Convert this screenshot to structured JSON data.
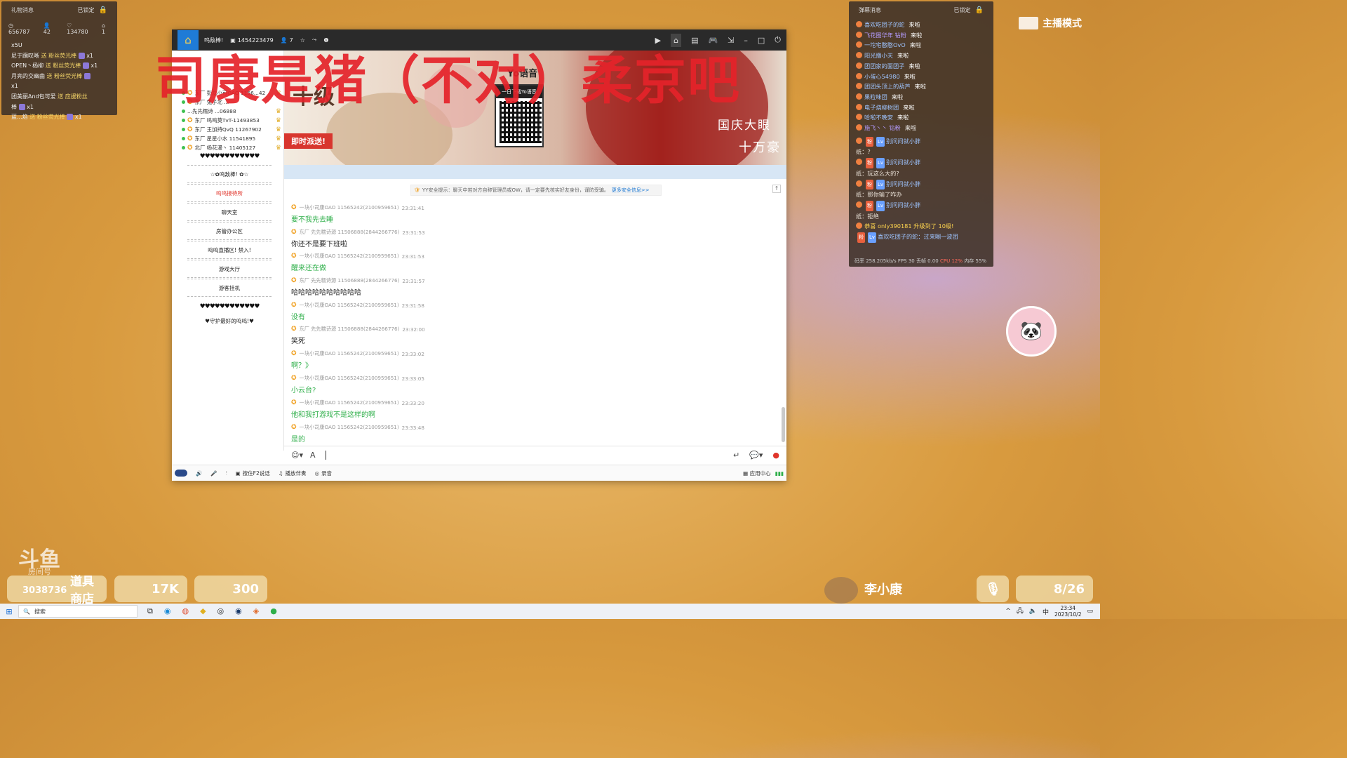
{
  "gift_panel": {
    "title": "礼物消息",
    "lock_label": "已锁定",
    "stats": [
      "656787",
      "42",
      "134780",
      "1"
    ],
    "items": [
      {
        "text": "x5U",
        "act": "",
        "gift": "",
        "count": ""
      },
      {
        "text": "尼于躏叹晰",
        "act": "送 粉丝荧光棒",
        "count": "x1"
      },
      {
        "text": "OPEN丶杨柳",
        "act": "送 粉丝荧光棒",
        "count": "x1"
      },
      {
        "text": "月亮的交幽曲",
        "act": "送 粉丝荧光棒",
        "count": ""
      },
      {
        "text": "x1",
        "act": "",
        "count": ""
      },
      {
        "text": "团美丽And包可爱",
        "act": "送 应援粉丝",
        "count": ""
      },
      {
        "text": "棒",
        "act": "",
        "count": "x1"
      },
      {
        "text": "蓝...焰",
        "act": "送 粉丝荧光棒",
        "count": "x1"
      }
    ]
  },
  "danmaku_panel": {
    "title": "弹幕消息",
    "lock_label": "已锁定",
    "arrivals": [
      "喜欢吃团子的蛇",
      "飞花图华年 钻粉",
      "一坨宅憨憨OvO",
      "阳光撸小天",
      "团团家的面团子",
      "小蛋心54980",
      "团团头顶上的葫芦",
      "果粒味团",
      "电子烧柳树团",
      "哈啦不晚安",
      "施飞丶丶 钻粉"
    ],
    "arrive_suffix": "来啦",
    "messages": [
      {
        "name": "别问问就小胖",
        "content": "纸：?"
      },
      {
        "name": "别问问就小胖",
        "content": "纸：玩这么大的?"
      },
      {
        "name": "别问问就小胖",
        "content": "纸：那你输了咋办"
      },
      {
        "name": "别问问就小胖",
        "content": "纸：拒绝"
      }
    ],
    "upgrade_prefix": "恭喜",
    "upgrade_text": "only390181 升级到了 10级!",
    "last_message": "喜欢吃团子的蛇：过来唰一波团",
    "status_bar": "码率 258.205kb/s FPS 30 丢帧 0.00",
    "cpu": "CPU 12%",
    "mem": "内存 55%"
  },
  "overlay_title": "司康是猪（不对）柔京吧",
  "yy_window": {
    "titlebar": {
      "name": "呜敌棒!",
      "room_id": "1454223479",
      "users": "7"
    },
    "channels": [
      {
        "text": "东厂 彭龙小可OAO 1156...42"
      },
      {
        "text": "东厂 兔子北 ..."
      },
      {
        "text": "...先先糯诗 ...06888"
      },
      {
        "text": "东厂 呜呜莫TvT-11493853"
      },
      {
        "text": "东厂 王加持QvQ 11267902"
      },
      {
        "text": "东厂 星星小水 11541895"
      },
      {
        "text": "北厂 杨花漫丶 11405127"
      }
    ],
    "hearts_top": "♥♥♥♥♥♥♥♥♥♥♥♥",
    "rooms": [
      "☆✿呜敌棒! ✿☆",
      "呜呜接待所",
      "聊天室",
      "房管办公区",
      "呜呜直播区! 禁入!",
      "游戏大厅",
      "游客挂机"
    ],
    "hearts_bottom": "♥♥♥♥♥♥♥♥♥♥♥♥",
    "guard_room": "守护最好的呜呜!",
    "banner": {
      "yo": "Yo语音",
      "qr_caption": "一日下载Yo语音",
      "level": "十级",
      "send": "即时派送!",
      "right1": "国庆大眼",
      "right2": "十万豪"
    },
    "security_tip": "YY安全提示：聊天中若对方自称管理员或OW，请一定要先核实好友身份，谨防受骗。",
    "security_link": "更多安全信息>>",
    "messages": [
      {
        "user": "一块小司康OAO 11565242(2100959651)",
        "time": "23:31:41",
        "text": "要不我先去睡",
        "color": "green"
      },
      {
        "user": "东厂 先先糯诗源 11506888(2844266776)",
        "time": "23:31:53",
        "text": "你还不是要下班啦",
        "color": "black"
      },
      {
        "user": "一块小司康OAO 11565242(2100959651)",
        "time": "23:31:53",
        "text": "醒来还在做",
        "color": "green"
      },
      {
        "user": "东厂 先先糯诗源 11506888(2844266776)",
        "time": "23:31:57",
        "text": "哈哈哈哈哈哈哈哈哈哈",
        "color": "black"
      },
      {
        "user": "一块小司康OAO 11565242(2100959651)",
        "time": "23:31:58",
        "text": "没有",
        "color": "green"
      },
      {
        "user": "东厂 先先糯诗源 11506888(2844266776)",
        "time": "23:32:00",
        "text": "笑死",
        "color": "black"
      },
      {
        "user": "一块小司康OAO 11565242(2100959651)",
        "time": "23:33:02",
        "text": "啊？》",
        "color": "green"
      },
      {
        "user": "一块小司康OAO 11565242(2100959651)",
        "time": "23:33:05",
        "text": "小云台?",
        "color": "green"
      },
      {
        "user": "一块小司康OAO 11565242(2100959651)",
        "time": "23:33:20",
        "text": "他和我打游戏不是这样的啊",
        "color": "green"
      },
      {
        "user": "一块小司康OAO 11565242(2100959651)",
        "time": "23:33:48",
        "text": "是的",
        "color": "green"
      }
    ],
    "bottom_bar": {
      "ptt": "按住F2说话",
      "music": "播放伴奏",
      "record": "录音",
      "app_center": "应用中心"
    }
  },
  "mode_label": "主播模式",
  "footer": {
    "douyu": "斗鱼",
    "douyu_sub": "房间号",
    "coord": "3038736",
    "tile_shop": "道具商店",
    "tile_1": "17K",
    "tile_2": "300",
    "streamer": "李小康",
    "tile_right": "8/26"
  },
  "taskbar": {
    "search": "搜索",
    "time": "23:34",
    "date": "2023/10/2"
  }
}
